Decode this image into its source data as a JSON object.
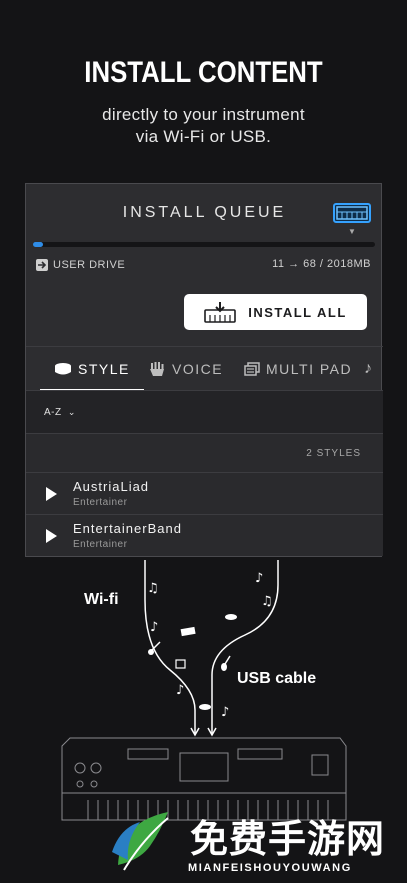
{
  "header": {
    "title": "INSTALL CONTENT",
    "subtitle_line1": "directly to your instrument",
    "subtitle_line2": "via Wi-Fi or USB."
  },
  "queue": {
    "title": "INSTALL QUEUE",
    "progress": 0.03,
    "drive_label": "USER DRIVE",
    "size_info": "11 → 68 / 2018MB",
    "install_all_label": "INSTALL ALL"
  },
  "tabs": [
    {
      "label": "STYLE",
      "icon": "drum-icon",
      "active": true
    },
    {
      "label": "VOICE",
      "icon": "piano-hand-icon",
      "active": false
    },
    {
      "label": "MULTI PAD",
      "icon": "multipad-icon",
      "active": false
    },
    {
      "label": "",
      "icon": "music-note-icon",
      "active": false
    }
  ],
  "sort": {
    "label": "A-Z"
  },
  "list": {
    "count": "2 STYLES",
    "items": [
      {
        "title": "AustriaLiad",
        "subtitle": "Entertainer"
      },
      {
        "title": "EntertainerBand",
        "subtitle": "Entertainer"
      }
    ]
  },
  "illustration": {
    "wifi_label": "Wi-fi",
    "usb_label": "USB cable"
  },
  "watermark": {
    "chinese": "免费手游网",
    "english": "MIANFEISHOUYOUWANG"
  },
  "colors": {
    "background": "#141416",
    "panel": "#2d2d30",
    "accent_blue": "#2f8de8"
  }
}
